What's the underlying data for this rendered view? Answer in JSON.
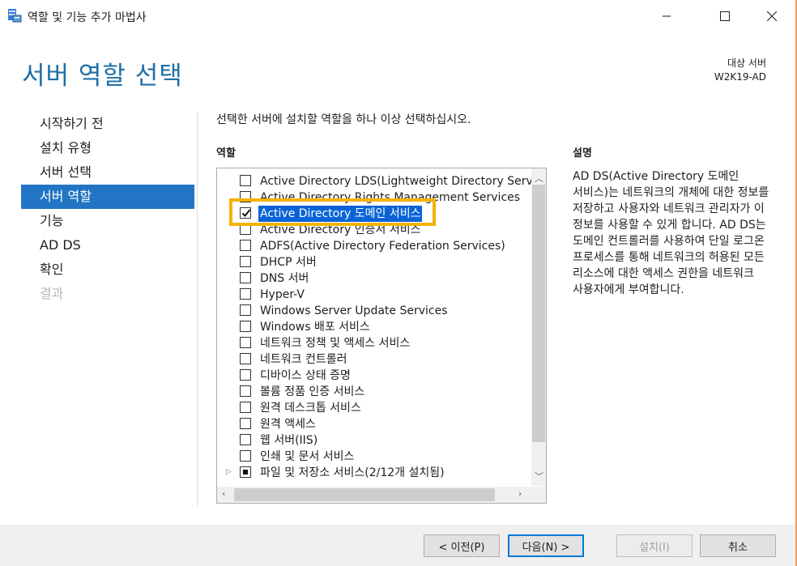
{
  "window": {
    "title": "역할 및 기능 추가 마법사",
    "icon": "server-manager-icon"
  },
  "page": {
    "heading": "서버 역할 선택",
    "target_label": "대상 서버",
    "target_server": "W2K19-AD"
  },
  "nav": {
    "items": [
      {
        "label": "시작하기 전",
        "state": "normal"
      },
      {
        "label": "설치 유형",
        "state": "normal"
      },
      {
        "label": "서버 선택",
        "state": "normal"
      },
      {
        "label": "서버 역할",
        "state": "active"
      },
      {
        "label": "기능",
        "state": "normal"
      },
      {
        "label": "AD DS",
        "state": "normal"
      },
      {
        "label": "확인",
        "state": "normal"
      },
      {
        "label": "결과",
        "state": "disabled"
      }
    ]
  },
  "main": {
    "instruction": "선택한 서버에 설치할 역할을 하나 이상 선택하십시오.",
    "roles_label": "역할",
    "description_label": "설명",
    "description_text": "AD DS(Active Directory 도메인 서비스)는 네트워크의 개체에 대한 정보를 저장하고 사용자와 네트워크 관리자가 이 정보를 사용할 수 있게 합니다. AD DS는 도메인 컨트롤러를 사용하여 단일 로그온 프로세스를 통해 네트워크의 허용된 모든 리소스에 대한 액세스 권한을 네트워크 사용자에게 부여합니다.",
    "roles": [
      {
        "label": "Active Directory LDS(Lightweight Directory Servic",
        "state": "unchecked"
      },
      {
        "label": "Active Directory Rights Management Services",
        "state": "unchecked"
      },
      {
        "label": "Active Directory 도메인 서비스",
        "state": "checked",
        "selected": true
      },
      {
        "label": "Active Directory 인증서 서비스",
        "state": "unchecked"
      },
      {
        "label": "ADFS(Active Directory Federation Services)",
        "state": "unchecked"
      },
      {
        "label": "DHCP 서버",
        "state": "unchecked"
      },
      {
        "label": "DNS 서버",
        "state": "unchecked"
      },
      {
        "label": "Hyper-V",
        "state": "unchecked"
      },
      {
        "label": "Windows Server Update Services",
        "state": "unchecked"
      },
      {
        "label": "Windows 배포 서비스",
        "state": "unchecked"
      },
      {
        "label": "네트워크 정책 및 액세스 서비스",
        "state": "unchecked"
      },
      {
        "label": "네트워크 컨트롤러",
        "state": "unchecked"
      },
      {
        "label": "디바이스 상태 증명",
        "state": "unchecked"
      },
      {
        "label": "볼륨 정품 인증 서비스",
        "state": "unchecked"
      },
      {
        "label": "원격 데스크톱 서비스",
        "state": "unchecked"
      },
      {
        "label": "원격 액세스",
        "state": "unchecked"
      },
      {
        "label": "웹 서버(IIS)",
        "state": "unchecked"
      },
      {
        "label": "인쇄 및 문서 서비스",
        "state": "unchecked"
      },
      {
        "label": "파일 및 저장소 서비스(2/12개 설치됨)",
        "state": "partial",
        "expandable": true
      }
    ]
  },
  "footer": {
    "prev_label": "< 이전(P)",
    "next_label": "다음(N) >",
    "install_label": "설치(I)",
    "cancel_label": "취소"
  },
  "colors": {
    "heading": "#1e6fa8",
    "nav_active": "#2274c4",
    "selection": "#0a64d7",
    "highlight_box": "#f3b304"
  }
}
